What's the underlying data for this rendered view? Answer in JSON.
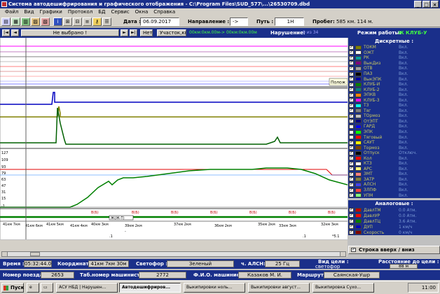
{
  "window": {
    "title": "Система автодешифрирования и графического отображения - C:\\Program Files\\SUD_577\\...\\26530709.dbd",
    "buttons": [
      "_",
      "□",
      "×"
    ]
  },
  "menu": [
    "Файл",
    "Вид",
    "Графики",
    "Протокол",
    "БД",
    "Сервис",
    "Окна",
    "Справка"
  ],
  "toolbar": {
    "date_label": "Дата :",
    "date_value": "06.09.2017",
    "direction_label": "Направление :",
    "direction_value": "->",
    "path_label": "Путь :",
    "path_value": "1Н",
    "mileage_label": "Пробег:",
    "mileage_value": "585 км. 114 м."
  },
  "navbar": {
    "first": "|◄",
    "prev": "◄",
    "selection": "Не выбрано !",
    "next": "►",
    "last": "►|",
    "no_label": "Нет",
    "section_label": "Участок,км",
    "range_text": "00км:0км.00м-> 00км:0км.00м",
    "violation_label": "Нарушение:",
    "violation_value": "0 из 34",
    "mode_label": "Режим работы:",
    "mode_value": "Ж КЛУБ-У"
  },
  "chart": {
    "tooltip": "Полож",
    "y_labels": [
      "127",
      "109",
      "93",
      "79",
      "63",
      "47",
      "31",
      "15",
      "-1"
    ],
    "event_labels": [
      "В(Б)",
      "В(Б)",
      "В(Б)",
      "В(Б)",
      "В(Б)",
      "В(Б)",
      "В(Б)"
    ],
    "zone_label": "Ж(Ж-Т)",
    "marks": [
      "-",
      ".1",
      ".1",
      "*5.1"
    ],
    "km_labels": [
      "41км 7км",
      "41км 6км",
      "41км 5км",
      "41км 4км",
      "40км 3км",
      "39км 2км",
      "37км 2км",
      "36км 2км",
      "35км 2км",
      "33км 3км",
      "32км 3км"
    ],
    "km_sub": [
      "-1",
      "-0",
      "-1",
      "-0",
      "-1",
      "-0",
      "-1",
      "-0",
      "-1",
      "-0",
      "-1"
    ]
  },
  "discrete": {
    "header": "Дискретные :",
    "items": [
      {
        "name": "ТОКМ",
        "val": "Вкл.",
        "color": "#808000",
        "checked": true
      },
      {
        "name": "ОЖТ",
        "val": "Вкл.",
        "color": "#ffffff",
        "checked": true
      },
      {
        "name": "РК",
        "val": "Вкл.",
        "color": "#00a0a0",
        "checked": true
      },
      {
        "name": "ВыкДиз",
        "val": "Вкл.",
        "color": "#800080",
        "checked": true
      },
      {
        "name": "ОТВ",
        "val": "Вкл.",
        "color": "#a0a0a0",
        "checked": true
      },
      {
        "name": "ПАЗ",
        "val": "Вкл.",
        "color": "#000000",
        "checked": true
      },
      {
        "name": "ВыкЭПК",
        "val": "Вкл.",
        "color": "#0000a0",
        "checked": true
      },
      {
        "name": "КЛУБ-И",
        "val": "Вкл.",
        "color": "#008000",
        "checked": true
      },
      {
        "name": "КЛУБ-2",
        "val": "Вкл.",
        "color": "#008080",
        "checked": true
      },
      {
        "name": "ЭПКВ",
        "val": "Вкл.",
        "color": "#ff8000",
        "checked": true
      },
      {
        "name": "КЛУБ-3",
        "val": "Вкл.",
        "color": "#ff00ff",
        "checked": true
      },
      {
        "name": "Т3",
        "val": "Вкл.",
        "color": "#00ffff",
        "checked": true
      },
      {
        "name": "Тяг",
        "val": "Вкл.",
        "color": "#808080",
        "checked": true
      },
      {
        "name": "ТОрмоз",
        "val": "Вкл.",
        "color": "#c0c0c0",
        "checked": true
      },
      {
        "name": "ОтЭПТ",
        "val": "Вкл.",
        "color": "#000080",
        "checked": true
      },
      {
        "name": "ГАРД",
        "val": "Вкл.",
        "color": "#0000ff",
        "checked": false
      },
      {
        "name": "ЭПК",
        "val": "Вкл.",
        "color": "#00ff00",
        "checked": false
      },
      {
        "name": "Тяговый",
        "val": "Вкл.",
        "color": "#ff0000",
        "checked": false
      },
      {
        "name": "САУТ",
        "val": "Вкл.",
        "color": "#ffff00",
        "checked": true
      },
      {
        "name": "Тормоз",
        "val": "Вкл.",
        "color": "#804000",
        "checked": true
      },
      {
        "name": "Отпуск",
        "val": "Отключ.",
        "color": "#000000",
        "checked": true
      },
      {
        "name": "Кол",
        "val": "Вкл.",
        "color": "#ff0000",
        "checked": true
      },
      {
        "name": "КТЗ",
        "val": "Вкл.",
        "color": "#ffffff",
        "checked": true
      },
      {
        "name": "АРС",
        "val": "Вкл.",
        "color": "#ffff80",
        "checked": true
      },
      {
        "name": "ЗМТ",
        "val": "Вкл.",
        "color": "#ff8080",
        "checked": true
      },
      {
        "name": "ЗАТР",
        "val": "Вкл.",
        "color": "#808040",
        "checked": true
      },
      {
        "name": "АЛСН",
        "val": "Вкл.",
        "color": "#4040ff",
        "checked": true
      },
      {
        "name": "ЗЛПФ",
        "val": "Вкл.",
        "color": "#ff4040",
        "checked": true
      },
      {
        "name": "УПМ",
        "val": "Вкл.",
        "color": "#80ff80",
        "checked": true
      }
    ]
  },
  "analog": {
    "header": "Аналоговые :",
    "items": [
      {
        "name": "ДавлТМ",
        "val": "0.0 Атм.",
        "color": "#c00000",
        "checked": true
      },
      {
        "name": "ДавлУР",
        "val": "0.0 Атм.",
        "color": "#ff0000",
        "checked": true
      },
      {
        "name": "ДавлТЦ",
        "val": "3.6 Атм.",
        "color": "#008000",
        "checked": true
      },
      {
        "name": "ДУП",
        "val": "1 км/ч",
        "color": "#0000c0",
        "checked": true
      },
      {
        "name": "Скорость",
        "val": "0 км/ч",
        "color": "#800000",
        "checked": true
      }
    ],
    "row_button": "Строка вверх / вниз"
  },
  "status": {
    "time_label": "Время :",
    "time_value": "05:32:44.0",
    "coord_label": "Координата :",
    "coord_value": "41км 7км 30м",
    "signal_label": "Светофор :",
    "signal_value": "Зеленый",
    "alsn_label": "ч. АЛСН:",
    "alsn_value": "25 Гц",
    "target_label": "Вид цели :",
    "target_value": "светофор",
    "distance_label": "Расстояние до цели :",
    "distance_value": "88 м",
    "train_label": "Номер поезда:",
    "train_value": "2653",
    "tab_label": "Таб.номер машиниста :",
    "tab_value": "2772",
    "fio_label": "Ф.И.О. машиниста:",
    "fio_value": "Казаков М. И.",
    "route_label": "Маршрут:",
    "route_value": "Саянская-Ушр"
  },
  "taskbar": {
    "start": "Пуск",
    "tasks": [
      "АСУ НБД | Нарушен...",
      "Автодешифриров...",
      "Выкипировки ноль...",
      "Выкипировки август...",
      "Выкипировка Сухо..."
    ],
    "clock": "11:00"
  }
}
